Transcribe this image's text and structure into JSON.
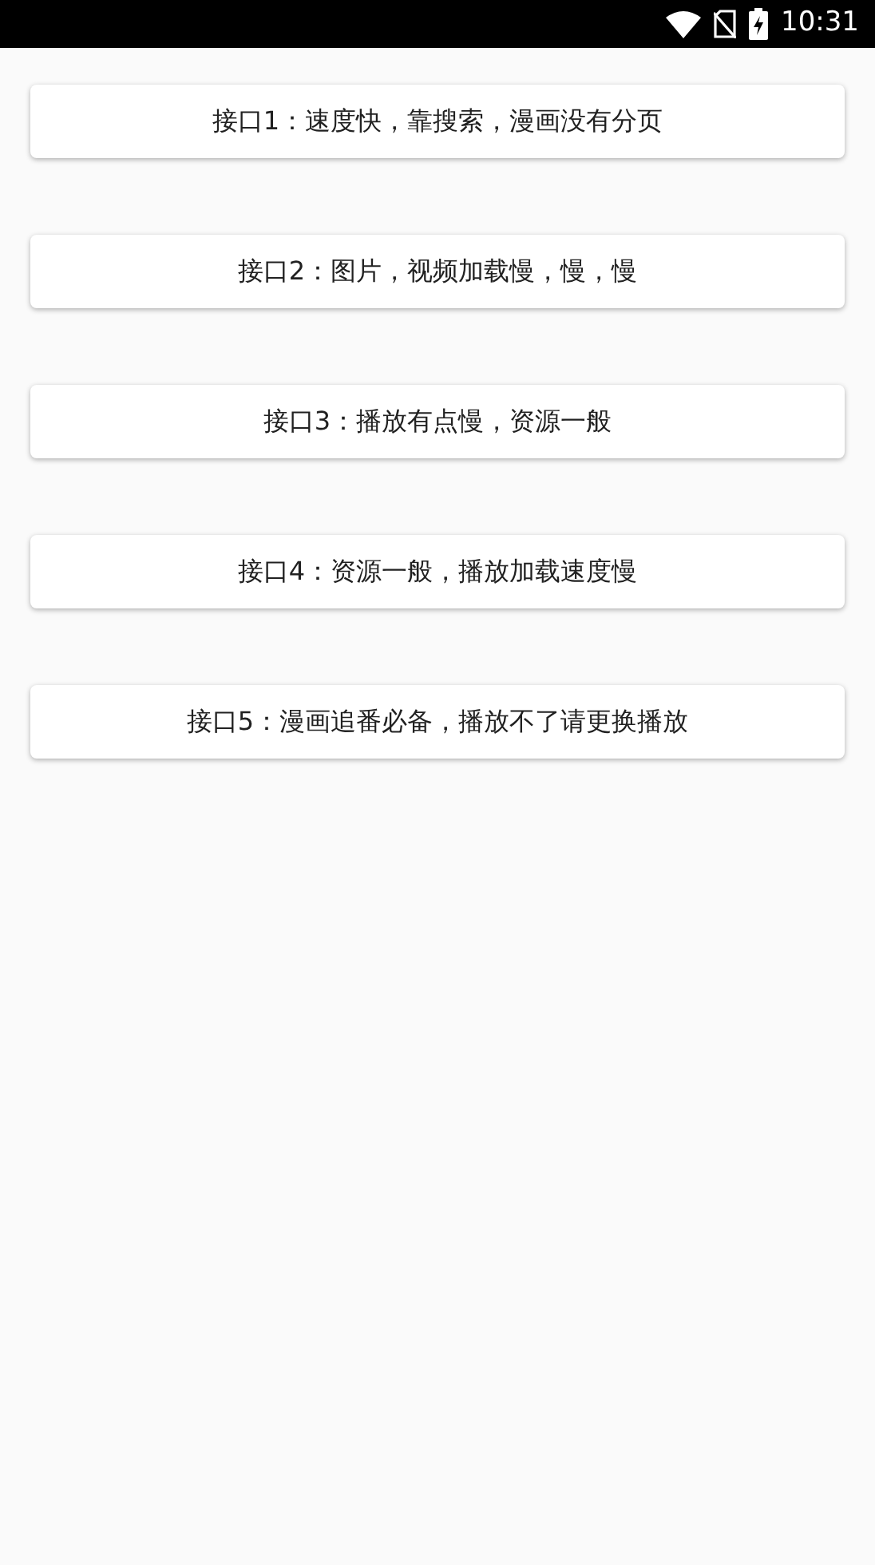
{
  "status_bar": {
    "time": "10:31"
  },
  "buttons": [
    {
      "label": "接口1：速度快，靠搜索，漫画没有分页"
    },
    {
      "label": "接口2：图片，视频加载慢，慢，慢"
    },
    {
      "label": "接口3：播放有点慢，资源一般"
    },
    {
      "label": "接口4：资源一般，播放加载速度慢"
    },
    {
      "label": "接口5：漫画追番必备，播放不了请更换播放"
    }
  ]
}
